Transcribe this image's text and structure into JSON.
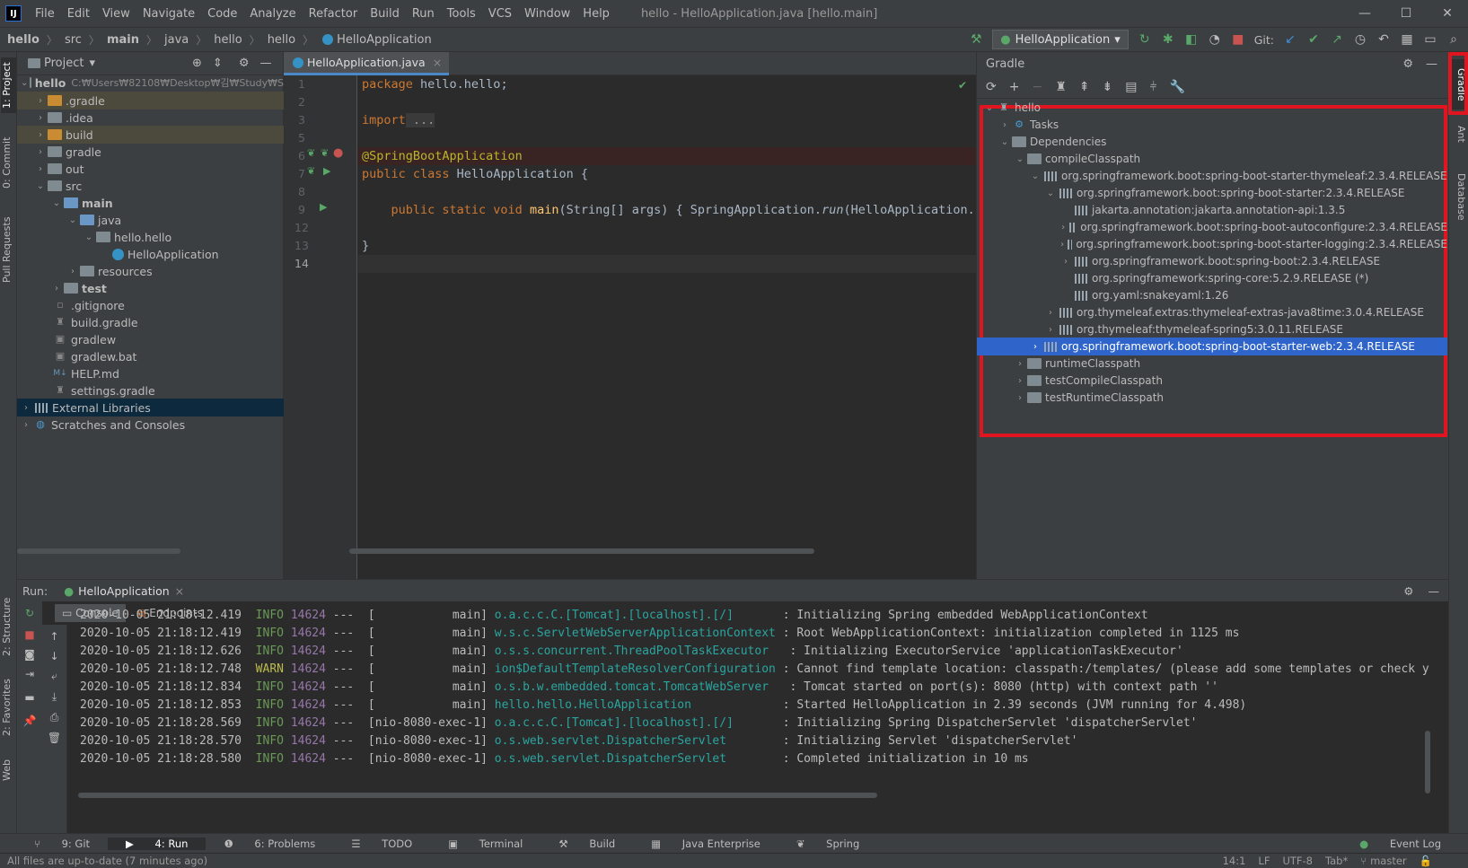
{
  "menubar": {
    "items": [
      "File",
      "Edit",
      "View",
      "Navigate",
      "Code",
      "Analyze",
      "Refactor",
      "Build",
      "Run",
      "Tools",
      "VCS",
      "Window",
      "Help"
    ],
    "title": "hello - HelloApplication.java [hello.main]"
  },
  "breadcrumb": [
    "hello",
    "src",
    "main",
    "java",
    "hello",
    "hello",
    "HelloApplication"
  ],
  "toolbar": {
    "run_config": "HelloApplication",
    "git_label": "Git:"
  },
  "leftstripe": [
    "1: Project",
    "0: Commit",
    "Pull Requests",
    "2: Structure",
    "2: Favorites",
    "Web"
  ],
  "rightstripe": [
    "Gradle",
    "Ant",
    "Database"
  ],
  "project": {
    "header": "Project",
    "root_name": "hello",
    "root_path": "C:₩Users₩82108₩Desktop₩김₩Study₩S",
    "items": [
      ".gradle",
      ".idea",
      "build",
      "gradle",
      "out",
      "src",
      "main",
      "java",
      "hello.hello",
      "HelloApplication",
      "resources",
      "test",
      ".gitignore",
      "build.gradle",
      "gradlew",
      "gradlew.bat",
      "HELP.md",
      "settings.gradle",
      "External Libraries",
      "Scratches and Consoles"
    ]
  },
  "editor": {
    "tab": "HelloApplication.java",
    "line_numbers": [
      "1",
      "2",
      "3",
      "5",
      "6",
      "7",
      "8",
      "9",
      "12",
      "13",
      "14"
    ],
    "code": {
      "l1_kw": "package",
      "l1_rest": " hello.hello;",
      "l3_kw": "import",
      "l3_rest": " ...",
      "l6": "@SpringBootApplication",
      "l7_kw": "public class",
      "l7_rest": " HelloApplication {",
      "l9_kw": "    public static void",
      "l9_fn": " main",
      "l9_rest": "(String[] args) { SpringApplication.",
      "l9_it": "run",
      "l9_tail": "(HelloApplication.c",
      "l13": "}"
    }
  },
  "gradle": {
    "title": "Gradle",
    "items": [
      "hello",
      "Tasks",
      "Dependencies",
      "compileClasspath",
      "org.springframework.boot:spring-boot-starter-thymeleaf:2.3.4.RELEASE",
      "org.springframework.boot:spring-boot-starter:2.3.4.RELEASE",
      "jakarta.annotation:jakarta.annotation-api:1.3.5",
      "org.springframework.boot:spring-boot-autoconfigure:2.3.4.RELEASE",
      "org.springframework.boot:spring-boot-starter-logging:2.3.4.RELEASE",
      "org.springframework.boot:spring-boot:2.3.4.RELEASE",
      "org.springframework:spring-core:5.2.9.RELEASE (*)",
      "org.yaml:snakeyaml:1.26",
      "org.thymeleaf.extras:thymeleaf-extras-java8time:3.0.4.RELEASE",
      "org.thymeleaf:thymeleaf-spring5:3.0.11.RELEASE",
      "org.springframework.boot:spring-boot-starter-web:2.3.4.RELEASE",
      "runtimeClasspath",
      "testCompileClasspath",
      "testRuntimeClasspath"
    ]
  },
  "run": {
    "label": "Run:",
    "config": "HelloApplication",
    "tabs": [
      "Console",
      "Endpoints"
    ],
    "logs": [
      {
        "ts": "2020-10-05 21:18:12.419",
        "lvl": "INFO",
        "pid": "14624",
        "thr": "---  [           main]",
        "cls": "o.a.c.c.C.[Tomcat].[localhost].[/]      ",
        "msg": " : Initializing Spring embedded WebApplicationContext"
      },
      {
        "ts": "2020-10-05 21:18:12.419",
        "lvl": "INFO",
        "pid": "14624",
        "thr": "---  [           main]",
        "cls": "w.s.c.ServletWebServerApplicationContext",
        "msg": " : Root WebApplicationContext: initialization completed in 1125 ms"
      },
      {
        "ts": "2020-10-05 21:18:12.626",
        "lvl": "INFO",
        "pid": "14624",
        "thr": "---  [           main]",
        "cls": "o.s.s.concurrent.ThreadPoolTaskExecutor  ",
        "msg": " : Initializing ExecutorService 'applicationTaskExecutor'"
      },
      {
        "ts": "2020-10-05 21:18:12.748",
        "lvl": "WARN",
        "pid": "14624",
        "thr": "---  [           main]",
        "cls": "ion$DefaultTemplateResolverConfiguration",
        "msg": " : Cannot find template location: classpath:/templates/ (please add some templates or check y"
      },
      {
        "ts": "2020-10-05 21:18:12.834",
        "lvl": "INFO",
        "pid": "14624",
        "thr": "---  [           main]",
        "cls": "o.s.b.w.embedded.tomcat.TomcatWebServer  ",
        "msg": " : Tomcat started on port(s): 8080 (http) with context path ''"
      },
      {
        "ts": "2020-10-05 21:18:12.853",
        "lvl": "INFO",
        "pid": "14624",
        "thr": "---  [           main]",
        "cls": "hello.hello.HelloApplication            ",
        "msg": " : Started HelloApplication in 2.39 seconds (JVM running for 4.498)"
      },
      {
        "ts": "2020-10-05 21:18:28.569",
        "lvl": "INFO",
        "pid": "14624",
        "thr": "---  [nio-8080-exec-1]",
        "cls": "o.a.c.c.C.[Tomcat].[localhost].[/]      ",
        "msg": " : Initializing Spring DispatcherServlet 'dispatcherServlet'"
      },
      {
        "ts": "2020-10-05 21:18:28.570",
        "lvl": "INFO",
        "pid": "14624",
        "thr": "---  [nio-8080-exec-1]",
        "cls": "o.s.web.servlet.DispatcherServlet       ",
        "msg": " : Initializing Servlet 'dispatcherServlet'"
      },
      {
        "ts": "2020-10-05 21:18:28.580",
        "lvl": "INFO",
        "pid": "14624",
        "thr": "---  [nio-8080-exec-1]",
        "cls": "o.s.web.servlet.DispatcherServlet       ",
        "msg": " : Completed initialization in 10 ms"
      }
    ]
  },
  "bottomtabs": [
    "9: Git",
    "4: Run",
    "6: Problems",
    "TODO",
    "Terminal",
    "Build",
    "Java Enterprise",
    "Spring"
  ],
  "event_log": "Event Log",
  "status": {
    "left": "All files are up-to-date (7 minutes ago)",
    "pos": "14:1",
    "le": "LF",
    "enc": "UTF-8",
    "indent": "Tab*",
    "branch": "master"
  }
}
